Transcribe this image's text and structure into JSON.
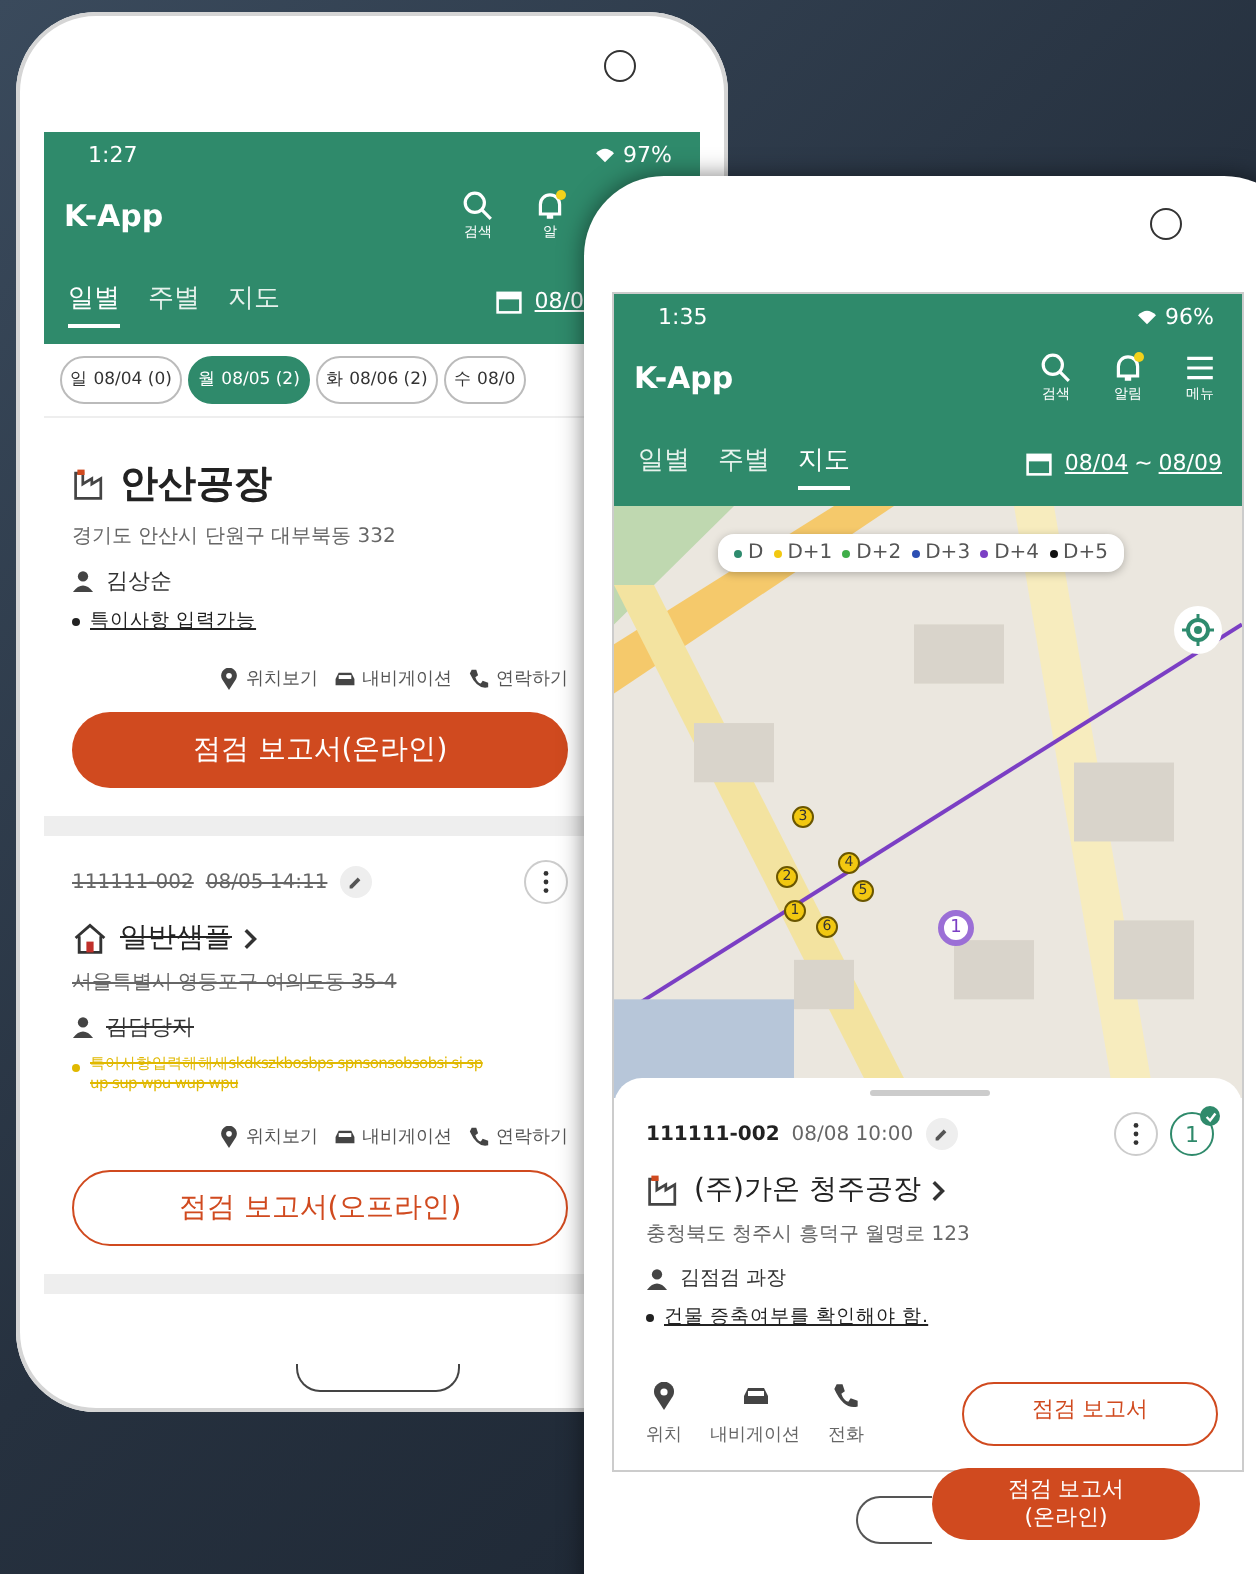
{
  "back_phone": {
    "status_bar": {
      "time": "1:27",
      "battery": "97%"
    },
    "app_title": "K-App",
    "header_actions": [
      {
        "label": "검색",
        "kind": "search"
      },
      {
        "label": "알",
        "kind": "bell",
        "badge": true
      }
    ],
    "tabs": [
      {
        "label": "일별",
        "selected": true
      },
      {
        "label": "주별",
        "selected": false
      },
      {
        "label": "지도",
        "selected": false
      }
    ],
    "date_range": [
      "08/0"
    ],
    "day_chips": [
      {
        "label": "일 08/04 (0)",
        "selected": false
      },
      {
        "label": "월 08/05 (2)",
        "selected": true
      },
      {
        "label": "화 08/06 (2)",
        "selected": false
      },
      {
        "label": "수 08/0",
        "selected": false
      }
    ],
    "cards": [
      {
        "completed": false,
        "kind": "factory",
        "title": "안산공장",
        "address": "경기도 안산시 단원구 대부북동 332",
        "contact": "김상순",
        "note": [
          "특이사항 입력가능"
        ],
        "actions": [
          {
            "label": "위치보기",
            "kind": "pin"
          },
          {
            "label": "내비게이션",
            "kind": "car"
          },
          {
            "label": "연락하기",
            "kind": "phone"
          }
        ],
        "report_button": {
          "label": "점검 보고서(온라인)",
          "kind": "online"
        }
      },
      {
        "completed": true,
        "id": "111111-002",
        "time": "08/05 14:11",
        "kind": "house",
        "title": "일반샘플",
        "address": "서울특별시 영등포구 여의도동 35-4",
        "contact": "김담당자",
        "note": [
          "특이사항입력해해새skdkszkbosbps spnsonsobsobsi si sp",
          "up sup wpu wup wpu"
        ],
        "actions": [
          {
            "label": "위치보기",
            "kind": "pin"
          },
          {
            "label": "내비게이션",
            "kind": "car"
          },
          {
            "label": "연락하기",
            "kind": "phone"
          }
        ],
        "report_button": {
          "label": "점검 보고서(오프라인)",
          "kind": "offline"
        }
      }
    ]
  },
  "front_phone": {
    "status_bar": {
      "time": "1:35",
      "battery": "96%"
    },
    "app_title": "K-App",
    "header_actions": [
      {
        "label": "검색",
        "kind": "search"
      },
      {
        "label": "알림",
        "kind": "bell",
        "badge": true
      },
      {
        "label": "메뉴",
        "kind": "menu"
      }
    ],
    "tabs": [
      {
        "label": "일별",
        "selected": false
      },
      {
        "label": "주별",
        "selected": false
      },
      {
        "label": "지도",
        "selected": true
      }
    ],
    "date_range": [
      "08/04",
      "~",
      "08/09"
    ],
    "legend": [
      {
        "label": "D",
        "color": "#2e8b6e"
      },
      {
        "label": "D+1",
        "color": "#f2c811"
      },
      {
        "label": "D+2",
        "color": "#3fae49"
      },
      {
        "label": "D+3",
        "color": "#2c4fb3"
      },
      {
        "label": "D+4",
        "color": "#7b3fc4"
      },
      {
        "label": "D+5",
        "color": "#111111"
      }
    ],
    "markers": [
      {
        "label": "1",
        "kind": "small"
      },
      {
        "label": "2",
        "kind": "small"
      },
      {
        "label": "3",
        "kind": "small"
      },
      {
        "label": "4",
        "kind": "small"
      },
      {
        "label": "5",
        "kind": "small"
      },
      {
        "label": "6",
        "kind": "small"
      },
      {
        "label": "1",
        "kind": "selected"
      }
    ],
    "sheet": {
      "id": "111111-002",
      "time": "08/08 10:00",
      "visit_count": {
        "label": "1",
        "checked": true
      },
      "kind": "factory",
      "title": "(주)가온 청주공장",
      "address": "충청북도 청주시 흥덕구 월명로 123",
      "contact": "김점검 과장",
      "note": "건물 증축여부를 확인해야 함.",
      "actions": [
        {
          "label": "위치",
          "kind": "pin"
        },
        {
          "label": "내비게이션",
          "kind": "car"
        },
        {
          "label": "전화",
          "kind": "phone"
        }
      ],
      "buttons": [
        {
          "lines": [
            "점검 보고서"
          ],
          "kind": "offline"
        },
        {
          "lines": [
            "점검 보고서",
            "(온라인)"
          ],
          "kind": "online"
        }
      ]
    }
  }
}
